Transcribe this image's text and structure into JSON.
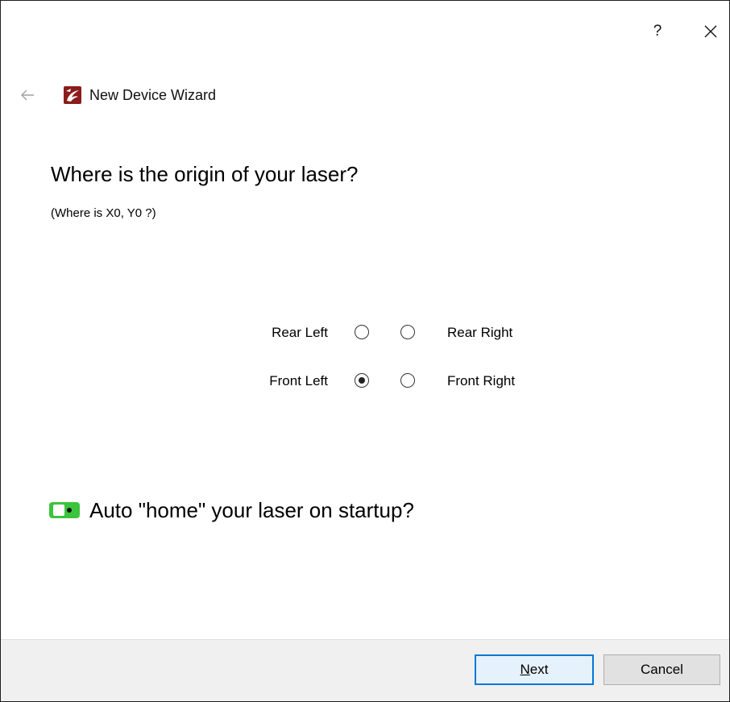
{
  "window": {
    "help_label": "?",
    "close_icon": "close-icon"
  },
  "header": {
    "back_icon": "back-arrow-icon",
    "logo_icon": "app-logo-icon",
    "title": "New Device Wizard"
  },
  "question": {
    "title": "Where is the origin of your laser?",
    "subtitle": "(Where is X0, Y0 ?)"
  },
  "origin": {
    "rear_left": "Rear Left",
    "rear_right": "Rear Right",
    "front_left": "Front Left",
    "front_right": "Front Right",
    "selected": "Front Left"
  },
  "auto_home": {
    "label": "Auto \"home\" your laser on startup?",
    "enabled": true,
    "accent_color": "#3cc43c"
  },
  "footer": {
    "next_accel": "N",
    "next_rest": "ext",
    "cancel_label": "Cancel",
    "accent_color": "#0078d7"
  }
}
